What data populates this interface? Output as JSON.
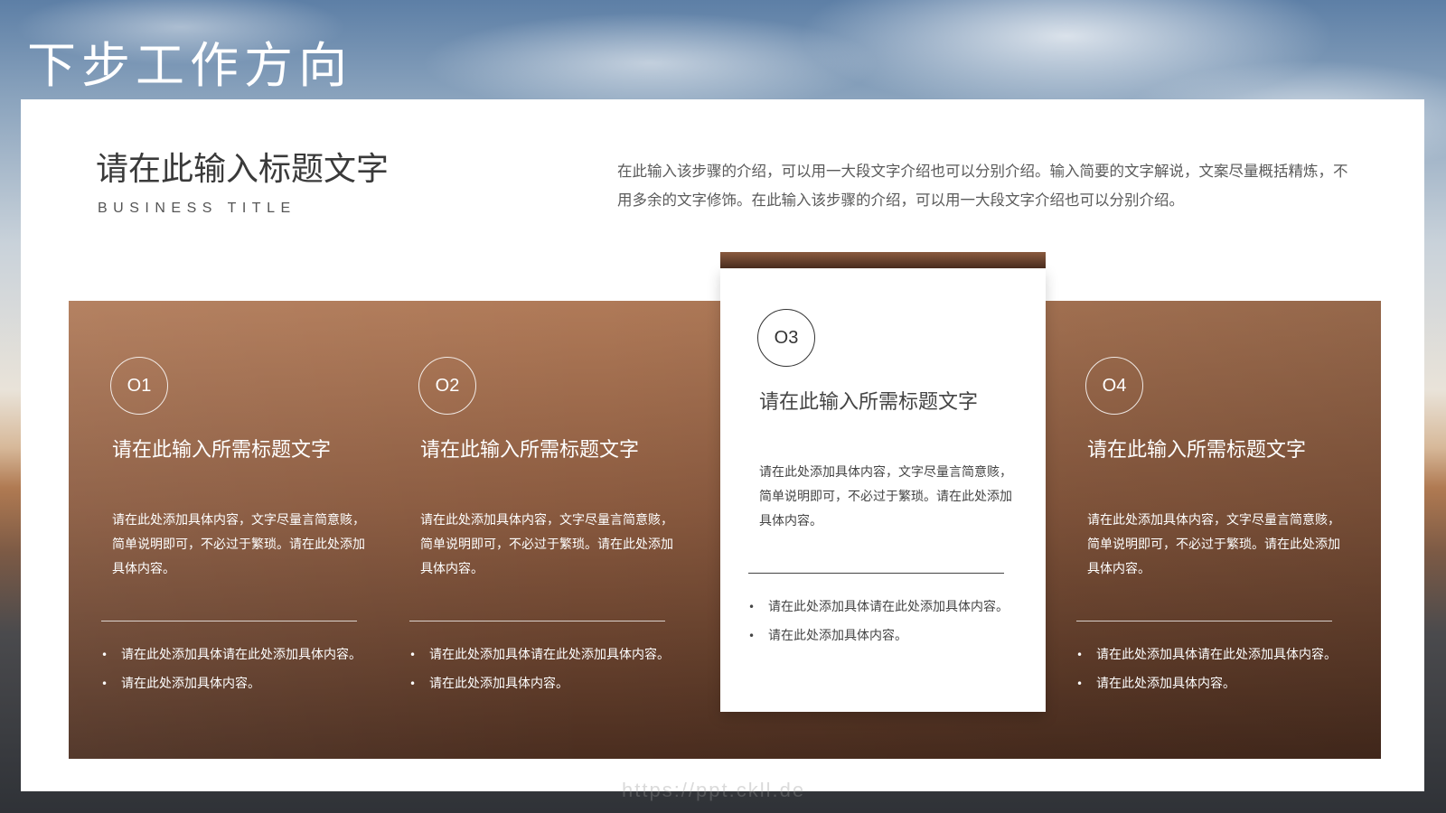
{
  "page_title": "下步工作方向",
  "section": {
    "title": "请在此输入标题文字",
    "subtitle": "BUSINESS TITLE",
    "intro": "在此输入该步骤的介绍，可以用一大段文字介绍也可以分别介绍。输入简要的文字解说，文案尽量概括精炼，不用多余的文字修饰。在此输入该步骤的介绍，可以用一大段文字介绍也可以分别介绍。"
  },
  "cards": [
    {
      "number": "O1",
      "title": "请在此输入所需标题文字",
      "body": "请在此处添加具体内容，文字尽量言简意赅，简单说明即可，不必过于繁琐。请在此处添加具体内容。",
      "bullets": [
        "请在此处添加具体请在此处添加具体内容。",
        "请在此处添加具体内容。"
      ]
    },
    {
      "number": "O2",
      "title": "请在此输入所需标题文字",
      "body": "请在此处添加具体内容，文字尽量言简意赅，简单说明即可，不必过于繁琐。请在此处添加具体内容。",
      "bullets": [
        "请在此处添加具体请在此处添加具体内容。",
        "请在此处添加具体内容。"
      ]
    },
    {
      "number": "O3",
      "title": "请在此输入所需标题文字",
      "body": "请在此处添加具体内容，文字尽量言简意赅，简单说明即可，不必过于繁琐。请在此处添加具体内容。",
      "bullets": [
        "请在此处添加具体请在此处添加具体内容。",
        "请在此处添加具体内容。"
      ]
    },
    {
      "number": "O4",
      "title": "请在此输入所需标题文字",
      "body": "请在此处添加具体内容，文字尽量言简意赅，简单说明即可，不必过于繁琐。请在此处添加具体内容。",
      "bullets": [
        "请在此处添加具体请在此处添加具体内容。",
        "请在此处添加具体内容。"
      ]
    }
  ],
  "bullet_glyph": "•",
  "watermark": "https://ppt.ckll.de",
  "colors": {
    "band_top": "#b07a58",
    "band_bottom": "#4a2d1f",
    "highlight_card": "#ffffff"
  }
}
